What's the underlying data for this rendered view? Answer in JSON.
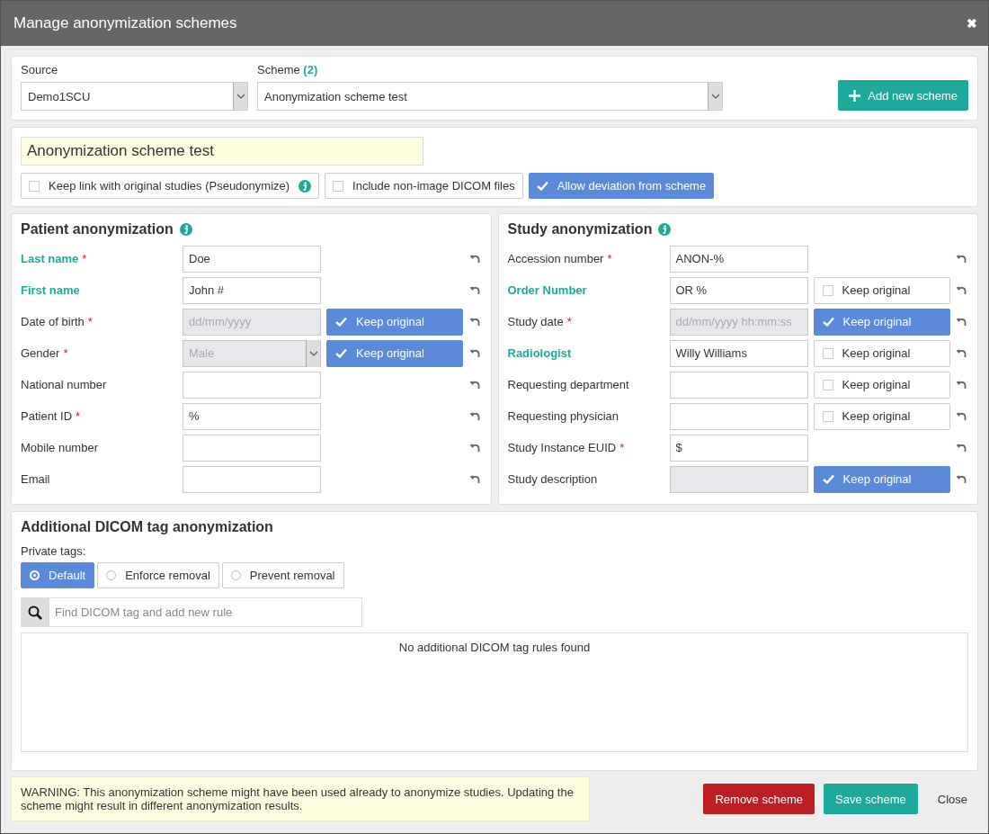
{
  "window": {
    "title": "Manage anonymization schemes",
    "close": "✖"
  },
  "source": {
    "label": "Source",
    "value": "Demo1SCU"
  },
  "scheme": {
    "label": "Scheme",
    "count": "(2)",
    "value": "Anonymization scheme test"
  },
  "add_button": {
    "label": "Add new scheme"
  },
  "scheme_name": {
    "value": "Anonymization scheme test"
  },
  "options": [
    {
      "label": "Keep link with original studies (Pseudonymize)",
      "checked": false,
      "info": true
    },
    {
      "label": "Include non-image DICOM files",
      "checked": false,
      "info": false
    },
    {
      "label": "Allow deviation from scheme",
      "checked": true,
      "info": false
    }
  ],
  "patient": {
    "title": "Patient anonymization",
    "fields": [
      {
        "label": "Last name",
        "required_mark": "*",
        "modified": true,
        "kind": "input",
        "value": "Doe",
        "disabled": false
      },
      {
        "label": "First name",
        "modified": true,
        "kind": "input",
        "value": "John #",
        "disabled": false
      },
      {
        "label": "Date of birth",
        "required_mark": "*",
        "modified": false,
        "kind": "input",
        "placeholder": "dd/mm/yyyy",
        "disabled": true,
        "keep": {
          "label": "Keep original",
          "checked": true
        }
      },
      {
        "label": "Gender",
        "required_mark": "*",
        "modified": false,
        "kind": "select",
        "value": "Male",
        "disabled": true,
        "keep": {
          "label": "Keep original",
          "checked": true
        }
      },
      {
        "label": "National number",
        "modified": false,
        "kind": "input",
        "disabled": false
      },
      {
        "label": "Patient ID",
        "required_mark": "*",
        "modified": false,
        "kind": "input",
        "value": "%",
        "disabled": false
      },
      {
        "label": "Mobile number",
        "modified": false,
        "kind": "input",
        "disabled": false
      },
      {
        "label": "Email",
        "modified": false,
        "kind": "input",
        "disabled": false
      }
    ]
  },
  "study": {
    "title": "Study anonymization",
    "fields": [
      {
        "label": "Accession number",
        "required_mark": "*",
        "modified": false,
        "kind": "input",
        "value": "ANON-%",
        "disabled": false
      },
      {
        "label": "Order Number",
        "modified": true,
        "kind": "input",
        "value": "OR %",
        "disabled": false,
        "keep": {
          "label": "Keep original",
          "checked": false
        }
      },
      {
        "label": "Study date",
        "required_mark": "*",
        "modified": false,
        "kind": "input",
        "placeholder": "dd/mm/yyyy hh:mm:ss",
        "disabled": true,
        "keep": {
          "label": "Keep original",
          "checked": true
        }
      },
      {
        "label": "Radiologist",
        "modified": true,
        "kind": "input",
        "value": "Willy Williams",
        "disabled": false,
        "keep": {
          "label": "Keep original",
          "checked": false
        }
      },
      {
        "label": "Requesting department",
        "modified": false,
        "kind": "input",
        "disabled": false,
        "keep": {
          "label": "Keep original",
          "checked": false
        }
      },
      {
        "label": "Requesting physician",
        "modified": false,
        "kind": "input",
        "disabled": false,
        "keep": {
          "label": "Keep original",
          "checked": false
        }
      },
      {
        "label": "Study Instance EUID",
        "required_mark": "*",
        "modified": false,
        "kind": "input",
        "value": "$",
        "disabled": false
      },
      {
        "label": "Study description",
        "modified": false,
        "kind": "input",
        "disabled": true,
        "keep": {
          "label": "Keep original",
          "checked": true
        }
      }
    ]
  },
  "additional": {
    "title": "Additional DICOM tag anonymization",
    "private_tags_label": "Private tags:",
    "private_tags": [
      {
        "label": "Default",
        "selected": true
      },
      {
        "label": "Enforce removal",
        "selected": false
      },
      {
        "label": "Prevent removal",
        "selected": false
      }
    ],
    "search": {
      "placeholder": "Find DICOM tag and add new rule"
    },
    "empty_message": "No additional DICOM tag rules found"
  },
  "warning": "WARNING: This anonymization scheme might have been used already to anonymize studies. Updating the scheme might result in different anonymization results.",
  "buttons": [
    {
      "label": "Remove scheme",
      "kind": "danger"
    },
    {
      "label": "Save scheme",
      "kind": "primary"
    },
    {
      "label": "Close",
      "kind": "link"
    }
  ]
}
